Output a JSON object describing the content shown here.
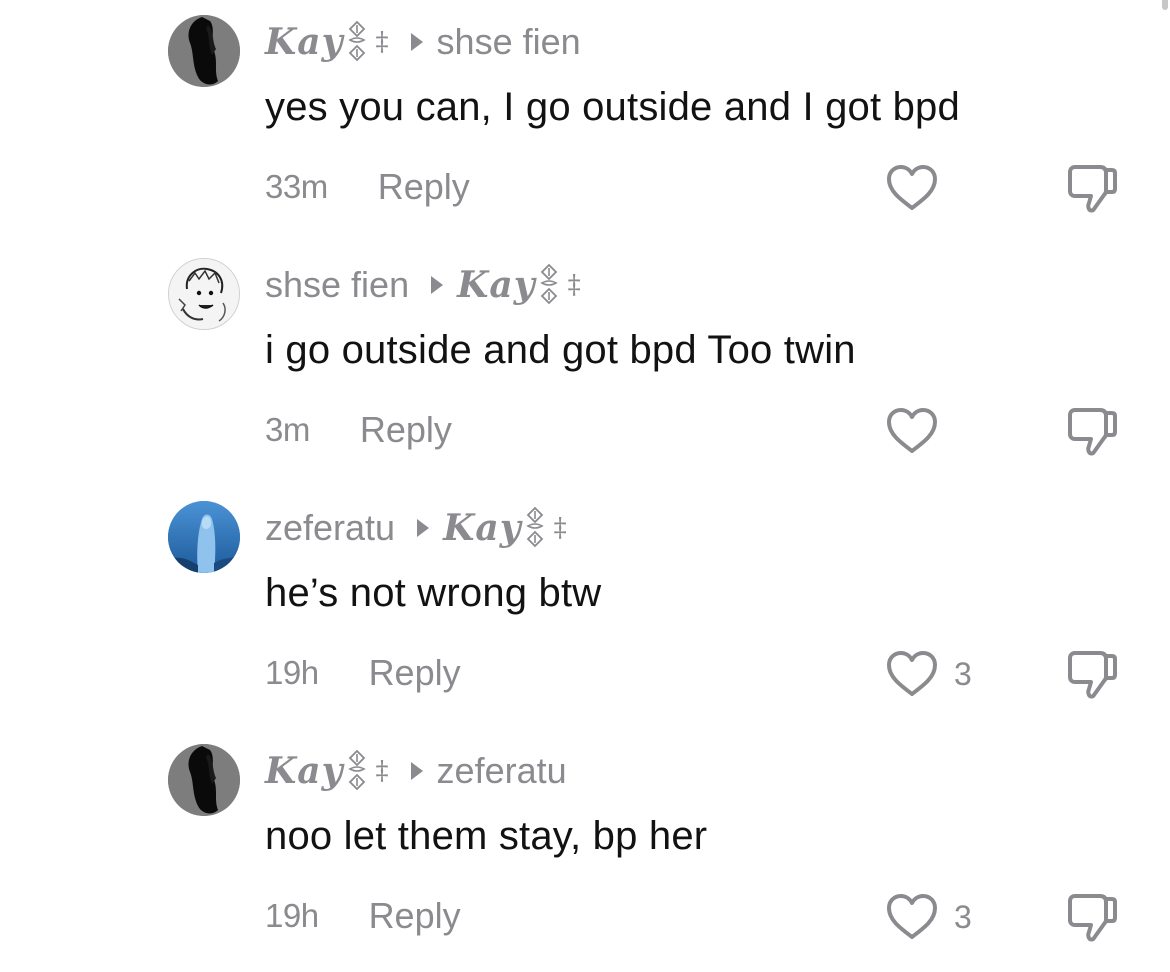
{
  "comments": [
    {
      "author": "Kay",
      "author_suffix": "‡",
      "author_style": "fancy",
      "avatar": "dark-silhouette-avatar",
      "replying_to": "shse fien",
      "replying_to_style": "plain",
      "text": "yes you can, I go outside and I got bpd",
      "time": "33m",
      "reply_label": "Reply",
      "likes": ""
    },
    {
      "author": "shse fien",
      "author_suffix": "",
      "author_style": "plain",
      "avatar": "sketch-avatar",
      "replying_to": "Kay",
      "replying_to_suffix": "‡",
      "replying_to_style": "fancy",
      "text": "i go outside and got bpd Too twin",
      "time": "3m",
      "reply_label": "Reply",
      "likes": ""
    },
    {
      "author": "zeferatu",
      "author_suffix": "",
      "author_style": "plain",
      "avatar": "blue-figure-avatar",
      "replying_to": "Kay",
      "replying_to_suffix": "‡",
      "replying_to_style": "fancy",
      "text": "he’s not wrong btw",
      "time": "19h",
      "reply_label": "Reply",
      "likes": "3"
    },
    {
      "author": "Kay",
      "author_suffix": "‡",
      "author_style": "fancy",
      "avatar": "dark-silhouette-avatar",
      "replying_to": "zeferatu",
      "replying_to_style": "plain",
      "text": "noo let them stay, bp her",
      "time": "19h",
      "reply_label": "Reply",
      "likes": "3"
    }
  ],
  "icons": {
    "like": "heart-outline-icon",
    "dislike": "thumbs-down-icon",
    "reply_indicator": "triangle-right-icon"
  },
  "colors": {
    "text_primary": "#121212",
    "text_secondary": "#8a8a8f",
    "background": "#ffffff"
  }
}
